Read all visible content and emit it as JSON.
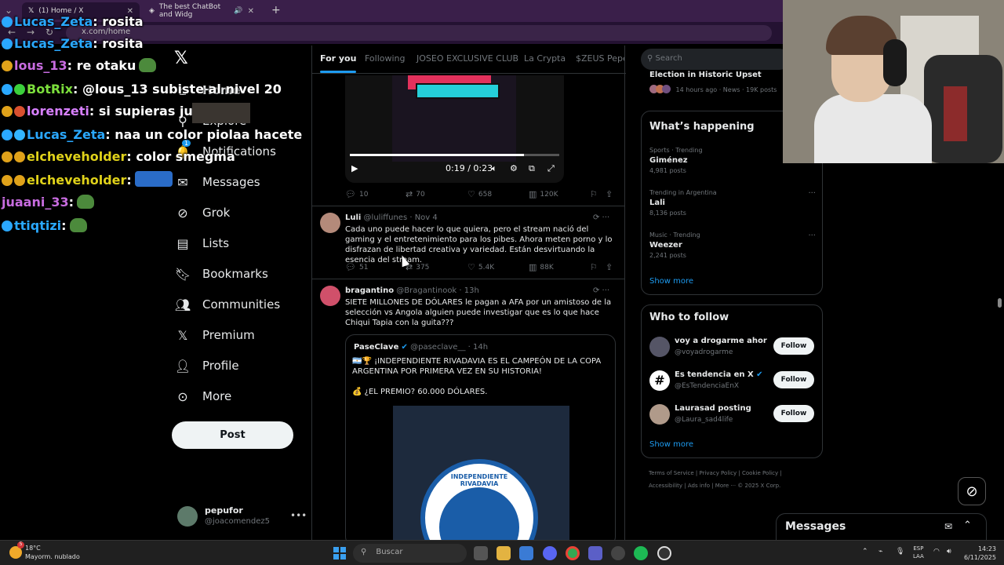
{
  "browser": {
    "tabs": [
      {
        "label": "(1) Home / X"
      },
      {
        "label": "The best ChatBot and Widg"
      }
    ],
    "url": "x.com/home"
  },
  "chat_overlay": {
    "lines": [
      {
        "user": "Lucas_Zeta",
        "msg": ": rosita",
        "color": "#2aa8ff"
      },
      {
        "user": "Lucas_Zeta",
        "msg": ": rosita",
        "color": "#2aa8ff"
      },
      {
        "user": "lous_13",
        "msg": ": re otaku",
        "color": "#c86ce0"
      },
      {
        "user": "BotRix",
        "msg": ": @lous_13 subiste al nivel 20",
        "color": "#7cdf3c"
      },
      {
        "user": "lorenzeti",
        "msg": ": si supieras juani",
        "color": "#d880ff"
      },
      {
        "user": "Lucas_Zeta",
        "msg": ": naa un color piolaa hacete",
        "color": "#2aa8ff"
      },
      {
        "user": "elcheveholder",
        "msg": ": color smegma",
        "color": "#e0d21a"
      },
      {
        "user": "elcheveholder",
        "msg": ":",
        "color": "#e0d21a"
      },
      {
        "user": "juaani_33",
        "msg": ":",
        "color": "#c86ce0"
      },
      {
        "user": "ttiqtizi",
        "msg": ":",
        "color": "#29a8ff"
      }
    ]
  },
  "nav": {
    "items": [
      {
        "label": "Home",
        "icon": "home-icon"
      },
      {
        "label": "Explore",
        "icon": "search-icon"
      },
      {
        "label": "Notifications",
        "icon": "bell-icon"
      },
      {
        "label": "Messages",
        "icon": "mail-icon"
      },
      {
        "label": "Grok",
        "icon": "grok-icon"
      },
      {
        "label": "Lists",
        "icon": "list-icon"
      },
      {
        "label": "Bookmarks",
        "icon": "bookmark-icon"
      },
      {
        "label": "Communities",
        "icon": "communities-icon"
      },
      {
        "label": "Premium",
        "icon": "x-icon"
      },
      {
        "label": "Profile",
        "icon": "person-icon"
      },
      {
        "label": "More",
        "icon": "more-circle-icon"
      }
    ],
    "post_label": "Post",
    "notif_count": "1",
    "account": {
      "name": "pepufor",
      "handle": "@joacomendez5"
    }
  },
  "feed": {
    "tabs": [
      "For you",
      "Following",
      "JOSEO EXCLUSIVE CLUB",
      "La Crypta",
      "$ZEUS Pepe's"
    ],
    "video": {
      "time": "0:19 / 0:23",
      "progress": 0.83
    },
    "video_stats": {
      "replies": "10",
      "reposts": "70",
      "likes": "658",
      "views": "120K"
    },
    "tweet1": {
      "name": "Luli",
      "handle": "@luliffunes",
      "time": "· Nov 4",
      "text": "Cada uno puede hacer lo que quiera, pero el stream nació del gaming y el entretenimiento para los pibes. Ahora meten porno y lo disfrazan de libertad creativa y variedad. Están desvirtuando la esencia del stream.",
      "replies": "51",
      "reposts": "375",
      "likes": "5.4K",
      "views": "88K"
    },
    "tweet2": {
      "name": "bragantino",
      "handle": "@Bragantinook",
      "time": "· 13h",
      "text": "SIETE MILLONES DE DÓLARES le pagan a AFA por un amistoso de la selección vs Angola alguien puede investigar que es lo que hace Chiqui Tapia con la guita???"
    },
    "quote": {
      "name": "PaseClave",
      "handle": "@paseclave__",
      "time": "· 14h",
      "text1": "🇦🇷🏆 ¡INDEPENDIENTE RIVADAVIA ES EL CAMPEÓN DE LA COPA ARGENTINA POR PRIMERA VEZ EN SU HISTORIA!",
      "text2": "💰 ¿EL PREMIO? 60.000 DÓLARES.",
      "crest_text": "INDEPENDIENTE RIVADAVIA"
    }
  },
  "right": {
    "search_placeholder": "Search",
    "top_story": "Election in Historic Upset",
    "top_meta": "14 hours ago · News · 19K posts",
    "whats_happening_title": "What’s happening",
    "trends": [
      {
        "context": "Sports · Trending",
        "name": "Giménez",
        "posts": "4,981 posts"
      },
      {
        "context": "Trending in Argentina",
        "name": "Lali",
        "posts": "8,136 posts"
      },
      {
        "context": "Music · Trending",
        "name": "Weezer",
        "posts": "2,241 posts"
      }
    ],
    "show_more": "Show more",
    "who_to_follow_title": "Who to follow",
    "follows": [
      {
        "name": "voy a drogarme ahora ...",
        "handle": "@voyadrogarme",
        "btn": "Follow"
      },
      {
        "name": "Es tendencia en X",
        "handle": "@EsTendenciaEnX",
        "btn": "Follow"
      },
      {
        "name": "Laurasad posting",
        "handle": "@Laura_sad4life",
        "btn": "Follow"
      }
    ],
    "footer1": "Terms of Service  |  Privacy Policy  |  Cookie Policy  |",
    "footer2": "Accessibility  |  Ads info  |  More ···  © 2025 X Corp.",
    "messages_label": "Messages"
  },
  "taskbar": {
    "temp": "18°C",
    "condition": "Mayorm. nublado",
    "weather_badge": "5",
    "search_placeholder": "Buscar",
    "lang1": "ESP",
    "lang2": "LAA",
    "time": "14:23",
    "date": "6/11/2025"
  }
}
